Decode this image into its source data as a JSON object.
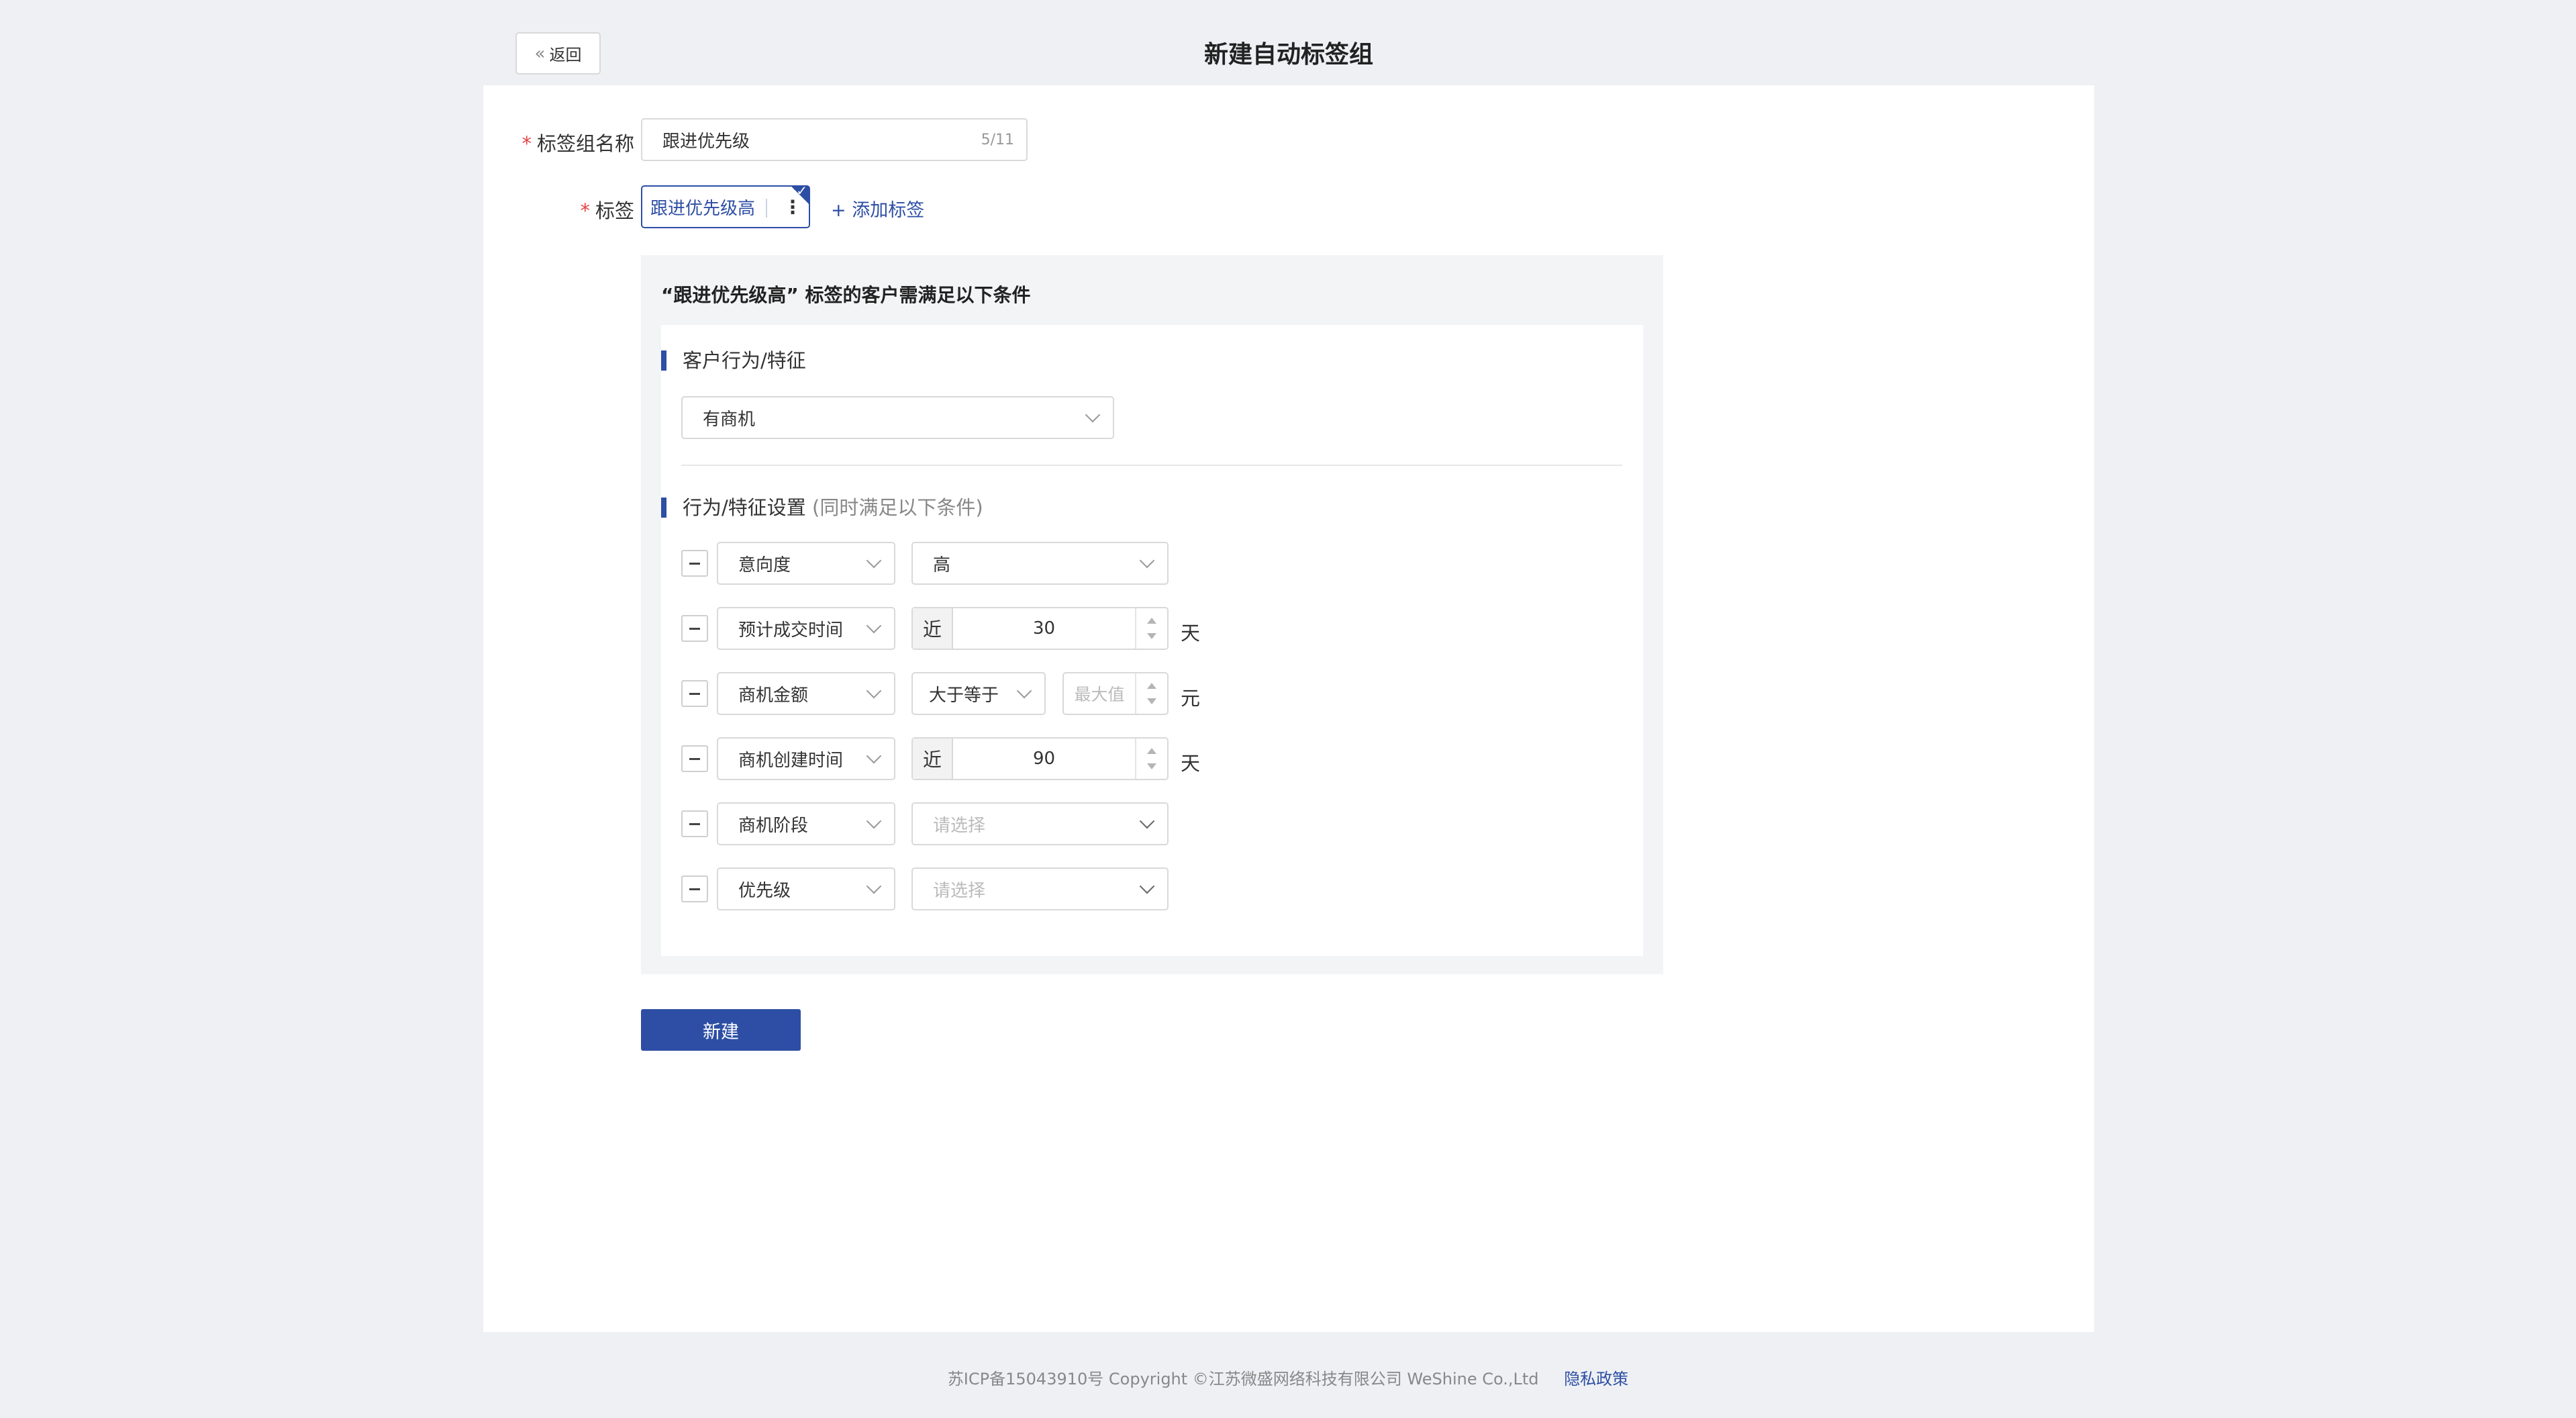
{
  "header": {
    "back_label": "返回",
    "back_chevron": "«",
    "title": "新建自动标签组"
  },
  "form": {
    "required_mark": "*",
    "name_label": "标签组名称",
    "name_value": "跟进优先级",
    "name_count": "5/11",
    "tag_label": "标签",
    "tags": [
      "跟进优先级高"
    ],
    "tag_kebab": "⋮",
    "tag_checkmark": "✓",
    "add_tag_label": "+ 添加标签"
  },
  "conditions": {
    "title": "“跟进优先级高” 标签的客户需满足以下条件",
    "behavior_section": "客户行为/特征",
    "behavior_select": "有商机",
    "settings_section": "行为/特征设置",
    "settings_hint": "(同时满足以下条件)",
    "rows": [
      {
        "field": "意向度",
        "value": "高"
      },
      {
        "field": "预计成交时间",
        "prefix": "近",
        "number": "30",
        "unit": "天"
      },
      {
        "field": "商机金额",
        "operator": "大于等于",
        "number_placeholder": "最大值",
        "unit": "元"
      },
      {
        "field": "商机创建时间",
        "prefix": "近",
        "number": "90",
        "unit": "天"
      },
      {
        "field": "商机阶段",
        "value_placeholder": "请选择"
      },
      {
        "field": "优先级",
        "value_placeholder": "请选择"
      }
    ]
  },
  "submit_label": "新建",
  "footer": {
    "text": "苏ICP备15043910号 Copyright ©江苏微盛网络科技有限公司 WeShine Co.,Ltd",
    "privacy_label": "隐私政策"
  },
  "colors": {
    "primary": "#2d4ea4",
    "required": "#e54545",
    "page_bg": "#eef0f4"
  }
}
